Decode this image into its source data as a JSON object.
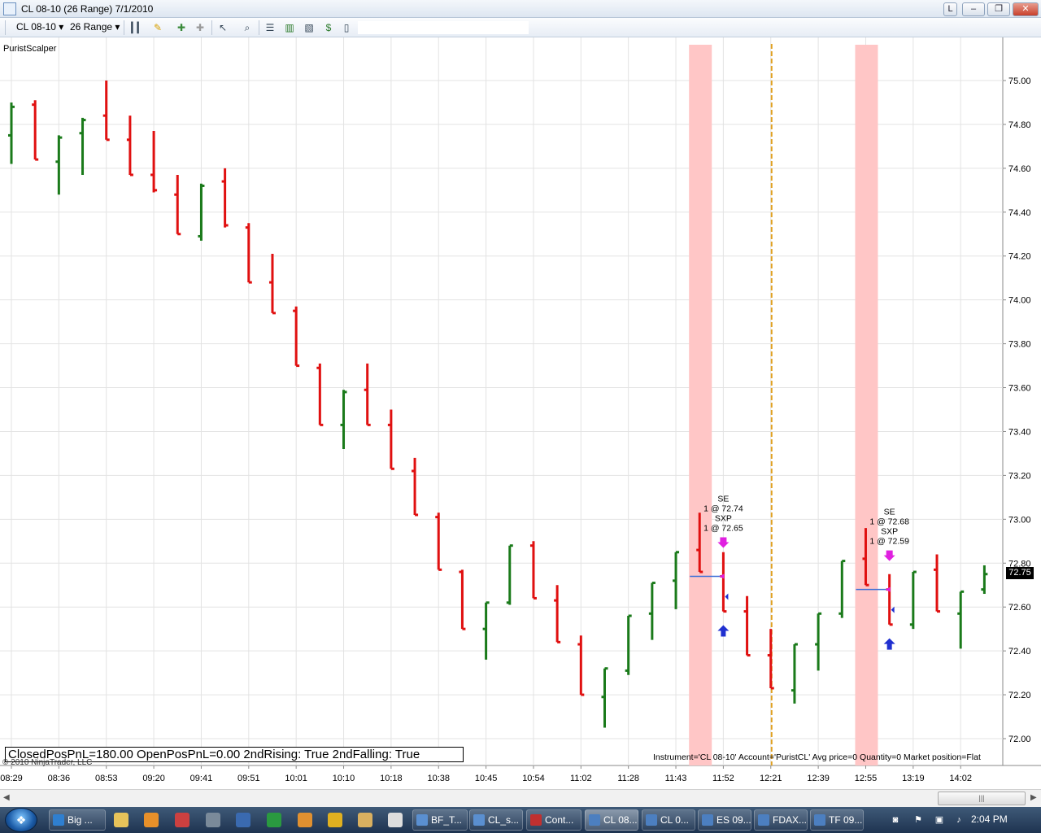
{
  "window": {
    "title": "CL 08-10 (26 Range)  7/1/2010",
    "controls": [
      "L",
      "–",
      "❐",
      "✕"
    ]
  },
  "toolbar": {
    "instrument": "CL 08-10",
    "period": "26 Range",
    "icons": [
      "bars-style-icon",
      "pencil-draw-icon",
      "crosshair-icon",
      "crosshair-alt-icon",
      "pointer-icon",
      "zoom-icon",
      "properties-icon",
      "strategy-icon",
      "indicators-icon",
      "dollar-icon",
      "data-box-icon"
    ]
  },
  "chart": {
    "indicator_label": "PuristScalper",
    "pnl_text": "ClosedPosPnL=180.00 OpenPosPnL=0.00 2ndRising: True 2ndFalling: True",
    "copyright": "© 2010 NinjaTrader, LLC",
    "instrument_info": "Instrument='CL 08-10' Account='PuristCL' Avg price=0 Quantity=0 Market position=Flat",
    "last_price": "72.75",
    "colors": {
      "up": "#1a7a1a",
      "down": "#e01010",
      "highlight": "#ffc6c6",
      "session_line": "#e0a020",
      "grid": "#e3e3e3"
    }
  },
  "chart_data": {
    "type": "ohlc",
    "ylim": [
      71.95,
      75.15
    ],
    "y_ticks": [
      "75.00",
      "74.80",
      "74.60",
      "74.40",
      "74.20",
      "74.00",
      "73.80",
      "73.60",
      "73.40",
      "73.20",
      "73.00",
      "72.80",
      "72.60",
      "72.40",
      "72.20",
      "72.00"
    ],
    "x_labels": [
      "08:29",
      "08:36",
      "08:53",
      "09:20",
      "09:41",
      "09:51",
      "10:01",
      "10:10",
      "10:18",
      "10:38",
      "10:45",
      "10:54",
      "11:02",
      "11:28",
      "11:43",
      "11:52",
      "12:21",
      "12:39",
      "12:55",
      "13:19",
      "14:02"
    ],
    "bars": [
      {
        "dir": "up",
        "h": 74.9,
        "l": 74.62,
        "o": 74.75,
        "c": 74.88
      },
      {
        "dir": "dn",
        "h": 74.91,
        "l": 74.64,
        "o": 74.89,
        "c": 74.64
      },
      {
        "dir": "up",
        "h": 74.75,
        "l": 74.48,
        "o": 74.63,
        "c": 74.74
      },
      {
        "dir": "up",
        "h": 74.83,
        "l": 74.57,
        "o": 74.76,
        "c": 74.82
      },
      {
        "dir": "dn",
        "h": 75.0,
        "l": 74.73,
        "o": 74.84,
        "c": 74.73
      },
      {
        "dir": "dn",
        "h": 74.84,
        "l": 74.57,
        "o": 74.73,
        "c": 74.57
      },
      {
        "dir": "dn",
        "h": 74.77,
        "l": 74.49,
        "o": 74.57,
        "c": 74.5
      },
      {
        "dir": "dn",
        "h": 74.57,
        "l": 74.3,
        "o": 74.48,
        "c": 74.3
      },
      {
        "dir": "up",
        "h": 74.53,
        "l": 74.27,
        "o": 74.29,
        "c": 74.52
      },
      {
        "dir": "dn",
        "h": 74.6,
        "l": 74.33,
        "o": 74.54,
        "c": 74.34
      },
      {
        "dir": "dn",
        "h": 74.35,
        "l": 74.08,
        "o": 74.33,
        "c": 74.08
      },
      {
        "dir": "dn",
        "h": 74.21,
        "l": 73.94,
        "o": 74.08,
        "c": 73.94
      },
      {
        "dir": "dn",
        "h": 73.97,
        "l": 73.7,
        "o": 73.95,
        "c": 73.7
      },
      {
        "dir": "dn",
        "h": 73.71,
        "l": 73.43,
        "o": 73.69,
        "c": 73.43
      },
      {
        "dir": "up",
        "h": 73.59,
        "l": 73.32,
        "o": 73.43,
        "c": 73.58
      },
      {
        "dir": "dn",
        "h": 73.71,
        "l": 73.43,
        "o": 73.59,
        "c": 73.43
      },
      {
        "dir": "dn",
        "h": 73.5,
        "l": 73.23,
        "o": 73.43,
        "c": 73.23
      },
      {
        "dir": "dn",
        "h": 73.28,
        "l": 73.02,
        "o": 73.22,
        "c": 73.02
      },
      {
        "dir": "dn",
        "h": 73.03,
        "l": 72.77,
        "o": 73.01,
        "c": 72.77
      },
      {
        "dir": "dn",
        "h": 72.77,
        "l": 72.5,
        "o": 72.76,
        "c": 72.5
      },
      {
        "dir": "up",
        "h": 72.62,
        "l": 72.36,
        "o": 72.5,
        "c": 72.62
      },
      {
        "dir": "up",
        "h": 72.88,
        "l": 72.61,
        "o": 72.62,
        "c": 72.88
      },
      {
        "dir": "dn",
        "h": 72.9,
        "l": 72.64,
        "o": 72.88,
        "c": 72.64
      },
      {
        "dir": "dn",
        "h": 72.7,
        "l": 72.44,
        "o": 72.63,
        "c": 72.44
      },
      {
        "dir": "dn",
        "h": 72.47,
        "l": 72.2,
        "o": 72.43,
        "c": 72.2
      },
      {
        "dir": "up",
        "h": 72.32,
        "l": 72.05,
        "o": 72.19,
        "c": 72.32
      },
      {
        "dir": "up",
        "h": 72.56,
        "l": 72.29,
        "o": 72.31,
        "c": 72.56
      },
      {
        "dir": "up",
        "h": 72.71,
        "l": 72.45,
        "o": 72.57,
        "c": 72.71
      },
      {
        "dir": "up",
        "h": 72.85,
        "l": 72.59,
        "o": 72.72,
        "c": 72.85
      },
      {
        "dir": "dn",
        "h": 73.03,
        "l": 72.76,
        "o": 72.86,
        "c": 72.76
      },
      {
        "dir": "dn",
        "h": 72.85,
        "l": 72.58,
        "o": 72.74,
        "c": 72.58
      },
      {
        "dir": "dn",
        "h": 72.65,
        "l": 72.38,
        "o": 72.58,
        "c": 72.38
      },
      {
        "dir": "dn",
        "h": 72.5,
        "l": 72.23,
        "o": 72.38,
        "c": 72.23
      },
      {
        "dir": "up",
        "h": 72.43,
        "l": 72.16,
        "o": 72.22,
        "c": 72.43
      },
      {
        "dir": "up",
        "h": 72.57,
        "l": 72.31,
        "o": 72.43,
        "c": 72.57
      },
      {
        "dir": "up",
        "h": 72.81,
        "l": 72.55,
        "o": 72.57,
        "c": 72.81
      },
      {
        "dir": "dn",
        "h": 72.96,
        "l": 72.7,
        "o": 72.82,
        "c": 72.7
      },
      {
        "dir": "dn",
        "h": 72.75,
        "l": 72.52,
        "o": 72.68,
        "c": 72.52
      },
      {
        "dir": "up",
        "h": 72.76,
        "l": 72.5,
        "o": 72.52,
        "c": 72.76
      },
      {
        "dir": "dn",
        "h": 72.84,
        "l": 72.58,
        "o": 72.77,
        "c": 72.58
      },
      {
        "dir": "up",
        "h": 72.67,
        "l": 72.41,
        "o": 72.57,
        "c": 72.67
      },
      {
        "dir": "up",
        "h": 72.79,
        "l": 72.66,
        "o": 72.68,
        "c": 72.75
      }
    ],
    "trades": [
      {
        "lines": [
          "SE",
          "1 @ 72.74",
          "SXP",
          "1 @ 72.65"
        ],
        "entry_bar": 29,
        "exit_bar": 30,
        "entry_price": 72.74
      },
      {
        "lines": [
          "SE",
          "1 @ 72.68",
          "SXP",
          "1 @ 72.59"
        ],
        "entry_bar": 36,
        "exit_bar": 37,
        "entry_price": 72.68
      }
    ],
    "highlight_bars": [
      29,
      36
    ],
    "session_break_bar": 32
  },
  "scrollbar": {
    "left_arrow": "◀",
    "right_arrow": "▶",
    "grip": "|||"
  },
  "taskbar": {
    "tasks": [
      {
        "label": "Big ...",
        "color": "#2f7fd0"
      },
      {
        "label": "BF_T...",
        "color": "#5a8fd0"
      },
      {
        "label": "CL_s...",
        "color": "#5a8fd0"
      },
      {
        "label": "Cont...",
        "color": "#c03030"
      },
      {
        "label": "CL 08...",
        "color": "#4c7fc0",
        "active": true
      },
      {
        "label": "CL 0...",
        "color": "#4c7fc0"
      },
      {
        "label": "ES 09...",
        "color": "#4c7fc0"
      },
      {
        "label": "FDAX...",
        "color": "#4c7fc0"
      },
      {
        "label": "TF 09...",
        "color": "#4c7fc0"
      }
    ],
    "clock": "2:04 PM"
  }
}
